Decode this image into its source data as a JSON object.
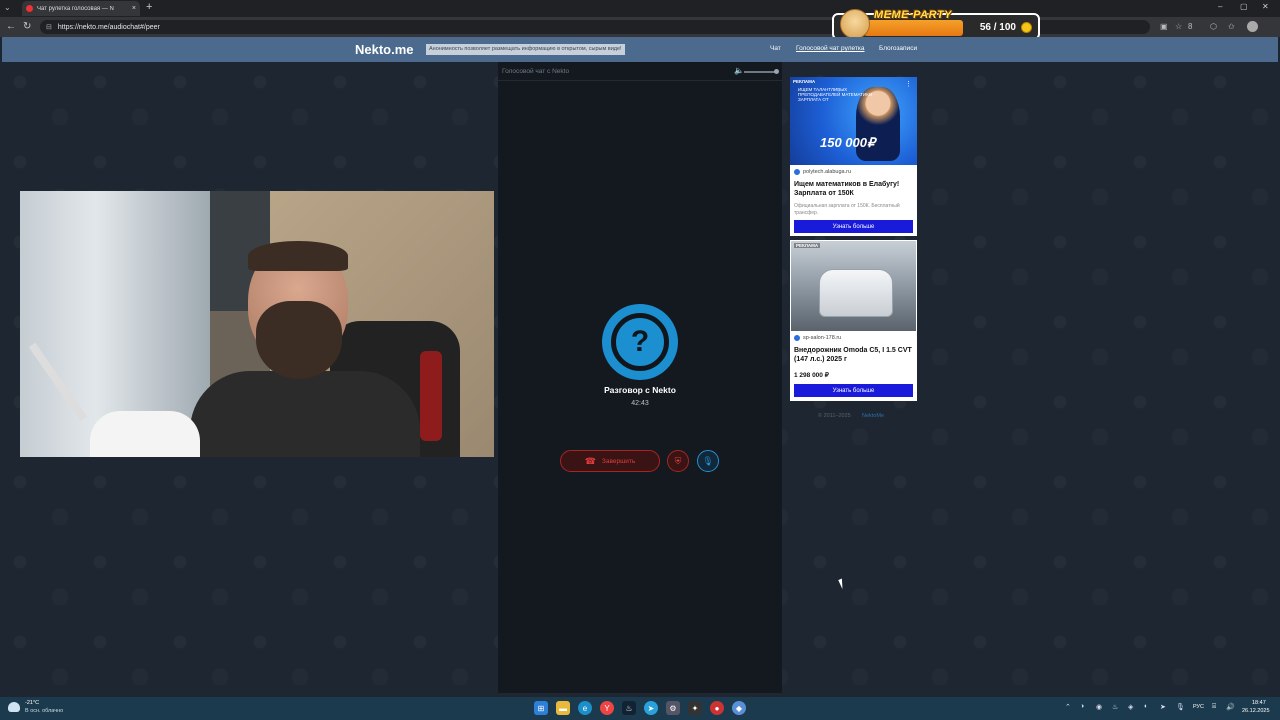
{
  "browser": {
    "tab_title": "Чат рулетка голосовая — N",
    "url": "https://nekto.me/audiochat#/peer",
    "tab_close": "×",
    "new_tab": "+",
    "window_controls": [
      "–",
      "▢",
      "✕"
    ],
    "toolbar_count": "8"
  },
  "meme_party": {
    "title": "MEME·PARTY",
    "progress_current": 56,
    "progress_max": 100,
    "counter_text": "56 / 100"
  },
  "site": {
    "logo": "Nekto.me",
    "notice": "Анонимность позволяет размещать информацию в открытом, сырым виде!",
    "nav": [
      {
        "label": "Чат",
        "active": false
      },
      {
        "label": "Голосовой чат рулетка",
        "active": true
      },
      {
        "label": "Блогозаписи",
        "active": false
      }
    ]
  },
  "voice_chat": {
    "panel_title": "Голосовой чат с Nekto",
    "avatar_symbol": "?",
    "peer_name": "Разговор с Nekto",
    "timer": "42:43",
    "end_button": "Завершить",
    "volume_level": 1.0
  },
  "ads": [
    {
      "label": "РЕКЛАМА",
      "image_small_text": "ИЩЕМ ТАЛАНТЛИВЫХ ПРЕПОДАВАТЕЛЕЙ МАТЕМАТИКИ · ЗАРПЛАТА ОТ",
      "image_big_text": "150 000₽",
      "domain": "polytech.alabuga.ru",
      "title": "Ищем математиков в Елабугу! Зарплата от 150К",
      "description": "Официальная зарплата от 150К. Бесплатный трансфер.",
      "button": "Узнать больше"
    },
    {
      "label": "РЕКЛАМА",
      "domain": "sp-salon-178.ru",
      "title": "Внедорожник Omoda C5, I 1.5 CVT (147 л.с.) 2025 г",
      "price": "1 298 000 ₽",
      "button": "Узнать больше"
    }
  ],
  "footer": {
    "copyright": "© 2011–2025",
    "link": "NektoMe"
  },
  "taskbar": {
    "temperature": "-21°C",
    "weather": "В осн. облачно",
    "language": "РУС",
    "time": "18:47",
    "date": "26.12.2025"
  }
}
